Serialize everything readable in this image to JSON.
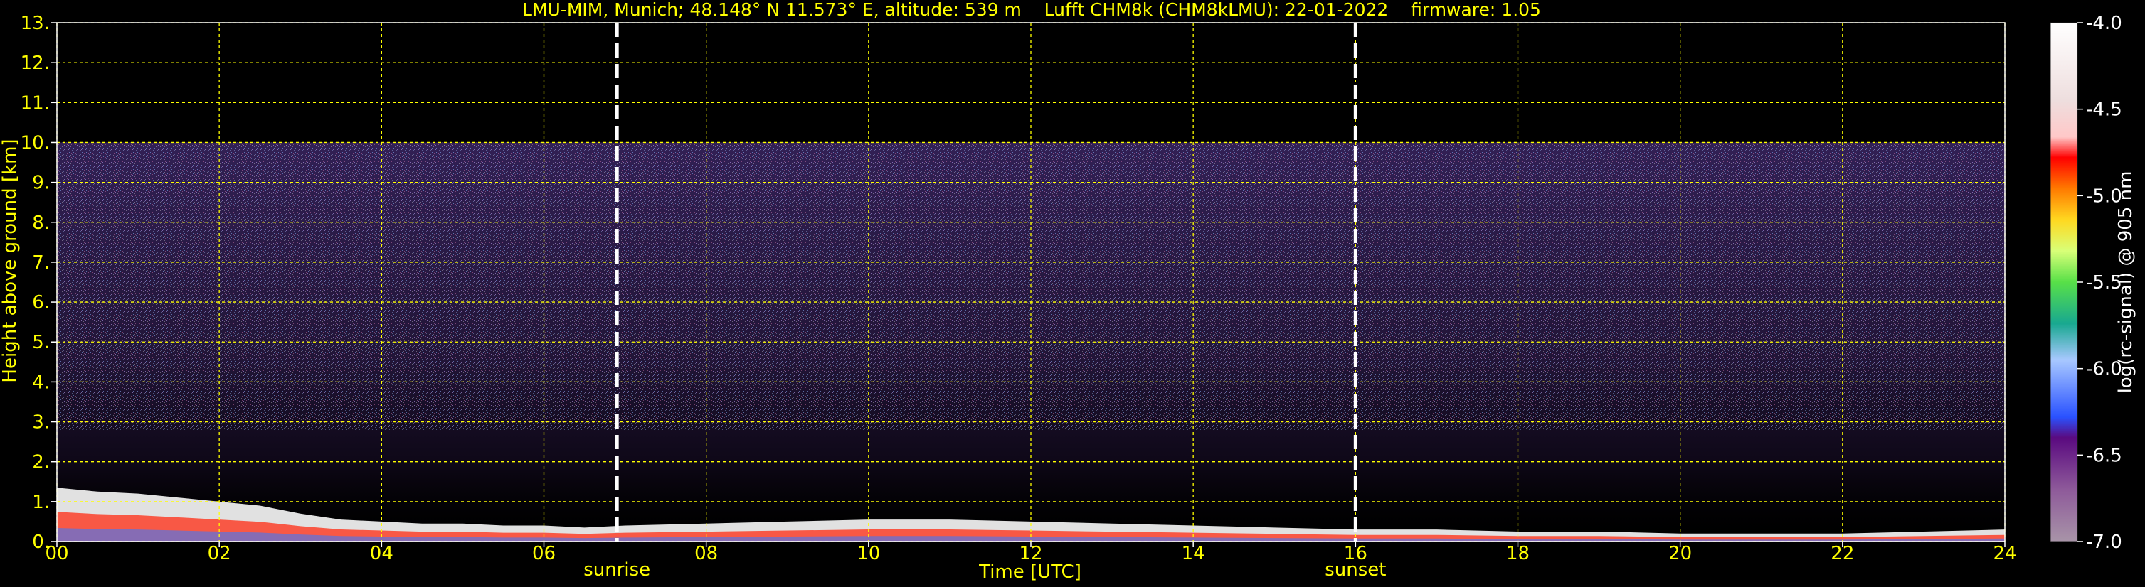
{
  "chart_data": {
    "type": "heatmap",
    "title": "LMU-MIM, Munich; 48.148° N 11.573° E, altitude: 539 m    Lufft CHM8k (CHM8kLMU): 22-01-2022    firmware: 1.05",
    "xlabel": "Time [UTC]",
    "ylabel": "Height above ground [km]",
    "xlim": [
      0,
      24
    ],
    "ylim": [
      0,
      13
    ],
    "x_ticks": [
      "00",
      "02",
      "04",
      "06",
      "08",
      "10",
      "12",
      "14",
      "16",
      "18",
      "20",
      "22",
      "24"
    ],
    "y_ticks": [
      "0.",
      "1.",
      "2.",
      "3.",
      "4.",
      "5.",
      "6.",
      "7.",
      "8.",
      "9.",
      "10.",
      "11.",
      "12.",
      "13."
    ],
    "grid": true,
    "grid_color": "#ffff00",
    "annotations": [
      {
        "x": 6.9,
        "label": "sunrise"
      },
      {
        "x": 16.0,
        "label": "sunset"
      }
    ],
    "noise_top_km": 10,
    "colorbar": {
      "label": "log(rc-signal) @ 905 nm",
      "range": [
        -7.0,
        -4.0
      ],
      "ticks": [
        "-4.0",
        "-4.5",
        "-5.0",
        "-5.5",
        "-6.0",
        "-6.5",
        "-7.0"
      ],
      "colors": [
        "#a894a8",
        "#9a7aa2",
        "#8e5a9a",
        "#7d3d92",
        "#6b1f8a",
        "#5a0a80",
        "#3a2aff",
        "#2a52ff",
        "#3a7aff",
        "#6a9aff",
        "#8ab4ff",
        "#a8c8ff",
        "#28c8c0",
        "#18a890",
        "#109818",
        "#28c028",
        "#58e048",
        "#98ee88",
        "#d8ff78",
        "#ffff50",
        "#ffd820",
        "#ffaa00",
        "#ff7a00",
        "#ff4a10",
        "#ff1000",
        "#ff0000",
        "#ffc8c8",
        "#eedede",
        "#ffffff",
        "#ffffff"
      ]
    },
    "boundary_layer_km": [
      [
        0.0,
        1.35
      ],
      [
        0.5,
        1.25
      ],
      [
        1.0,
        1.2
      ],
      [
        1.5,
        1.1
      ],
      [
        2.0,
        1.0
      ],
      [
        2.5,
        0.9
      ],
      [
        3.0,
        0.7
      ],
      [
        3.5,
        0.55
      ],
      [
        4.0,
        0.5
      ],
      [
        4.5,
        0.45
      ],
      [
        5.0,
        0.45
      ],
      [
        5.5,
        0.4
      ],
      [
        6.0,
        0.4
      ],
      [
        6.5,
        0.35
      ],
      [
        7.0,
        0.4
      ],
      [
        8.0,
        0.45
      ],
      [
        9.0,
        0.5
      ],
      [
        10.0,
        0.55
      ],
      [
        11.0,
        0.55
      ],
      [
        12.0,
        0.5
      ],
      [
        13.0,
        0.45
      ],
      [
        14.0,
        0.4
      ],
      [
        15.0,
        0.35
      ],
      [
        16.0,
        0.3
      ],
      [
        17.0,
        0.3
      ],
      [
        18.0,
        0.25
      ],
      [
        19.0,
        0.25
      ],
      [
        20.0,
        0.2
      ],
      [
        21.0,
        0.2
      ],
      [
        22.0,
        0.2
      ],
      [
        23.0,
        0.25
      ],
      [
        24.0,
        0.3
      ]
    ]
  }
}
